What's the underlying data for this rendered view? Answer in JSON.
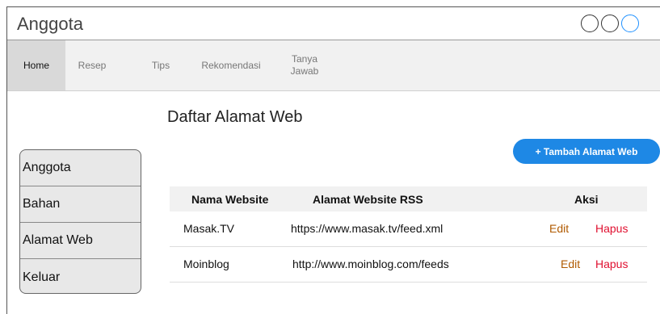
{
  "window": {
    "title": "Anggota",
    "controls": [
      "circle-button",
      "circle-button",
      "circle-button"
    ]
  },
  "nav": {
    "items": [
      {
        "label": "Home",
        "active": true
      },
      {
        "label": "Resep",
        "active": false
      },
      {
        "label": "Tips",
        "active": false
      },
      {
        "label": "Rekomendasi",
        "active": false
      },
      {
        "label": "Tanya Jawab",
        "line1": "Tanya",
        "line2": "Jawab",
        "active": false
      }
    ]
  },
  "main": {
    "title": "Daftar Alamat Web",
    "add_button_label": "+ Tambah Alamat Web"
  },
  "sidebar": {
    "items": [
      {
        "label": "Anggota"
      },
      {
        "label": "Bahan"
      },
      {
        "label": "Alamat Web"
      },
      {
        "label": "Keluar"
      }
    ]
  },
  "table": {
    "headers": {
      "name": "Nama Website",
      "rss": "Alamat Website RSS",
      "action": "Aksi"
    },
    "rows": [
      {
        "name": "Masak.TV",
        "rss": "https://www.masak.tv/feed.xml",
        "edit": "Edit",
        "delete": "Hapus"
      },
      {
        "name": "Moinblog",
        "rss": "http://www.moinblog.com/feeds",
        "edit": "Edit",
        "delete": "Hapus"
      }
    ]
  },
  "colors": {
    "accent": "#1e88e5",
    "edit": "#b05a00",
    "delete": "#e01030"
  }
}
